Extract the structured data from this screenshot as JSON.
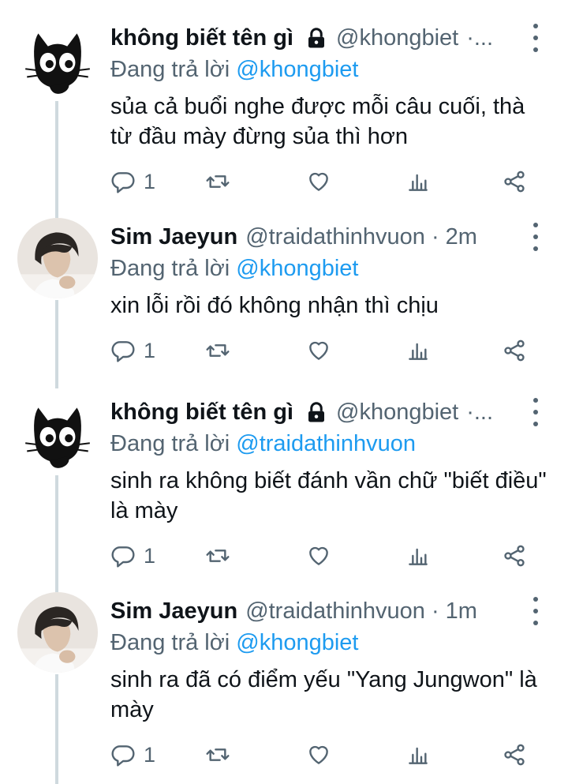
{
  "colors": {
    "link": "#1d9bf0",
    "secondary": "#536471",
    "text": "#0f1419",
    "thread_line": "#cfd9de"
  },
  "tweets": [
    {
      "avatar": "black-cat-avatar",
      "name": "không biết tên gì",
      "protected": true,
      "handle": "@khongbiet",
      "time": "·...",
      "replying_prefix": "Đang trả lời",
      "replying_to": "@khongbiet",
      "text": "sủa cả buổi nghe được mỗi câu cuối, thà từ đầu mày đừng sủa thì hơn",
      "reply_count": "1"
    },
    {
      "avatar": "person-photo-avatar",
      "name": "Sim Jaeyun",
      "protected": false,
      "handle": "@traidathinhvuon",
      "time": "2m",
      "replying_prefix": "Đang trả lời",
      "replying_to": "@khongbiet",
      "text": "xin lỗi rồi đó không nhận thì chịu",
      "reply_count": "1"
    },
    {
      "avatar": "black-cat-avatar",
      "name": "không biết tên gì",
      "protected": true,
      "handle": "@khongbiet",
      "time": "·...",
      "replying_prefix": "Đang trả lời",
      "replying_to": "@traidathinhvuon",
      "text": "sinh ra không biết đánh vần chữ \"biết điều\" là mày",
      "reply_count": "1"
    },
    {
      "avatar": "person-photo-avatar",
      "name": "Sim Jaeyun",
      "protected": false,
      "handle": "@traidathinhvuon",
      "time": "1m",
      "replying_prefix": "Đang trả lời",
      "replying_to": "@khongbiet",
      "text": "sinh ra đã có điểm yếu \"Yang Jungwon\" là mày",
      "reply_count": "1"
    }
  ]
}
